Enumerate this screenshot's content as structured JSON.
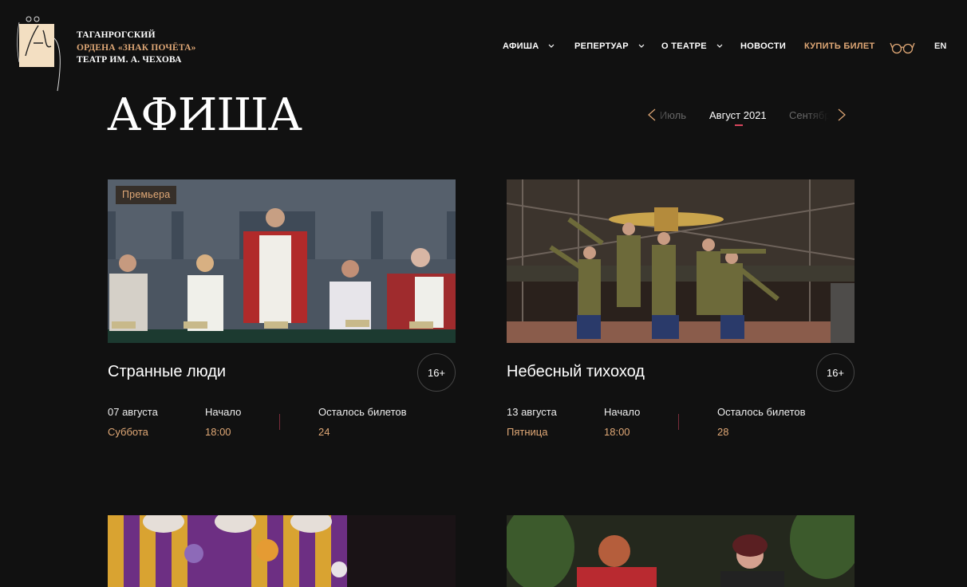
{
  "header": {
    "logo_line1": "ТАГАНРОГСКИЙ",
    "logo_line2": "ОРДЕНА «ЗНАК ПОЧЁТА»",
    "logo_line3": "ТЕАТР ИМ. А. ЧЕХОВА",
    "nav": [
      {
        "label": "АФИША",
        "has_dropdown": true
      },
      {
        "label": "РЕПЕРТУАР",
        "has_dropdown": true
      },
      {
        "label": "О ТЕАТРЕ",
        "has_dropdown": true
      },
      {
        "label": "НОВОСТИ",
        "has_dropdown": false
      },
      {
        "label": "КУПИТЬ БИЛЕТ",
        "has_dropdown": false
      }
    ],
    "accessibility_icon": "glasses-icon",
    "language": "EN"
  },
  "page": {
    "title": "АФИША"
  },
  "month_switcher": {
    "prev_label": "Июль",
    "current_label": "Август 2021",
    "next_label": "Сентябрь"
  },
  "events": [
    {
      "badge": "Премьера",
      "title": "Странные люди",
      "age": "16+",
      "date_label": "07 августа",
      "weekday": "Суббота",
      "start_label": "Начало",
      "start_time": "18:00",
      "tickets_label": "Осталось билетов",
      "tickets_left": "24"
    },
    {
      "badge": "",
      "title": "Небесный тихоход",
      "age": "16+",
      "date_label": "13 августа",
      "weekday": "Пятница",
      "start_label": "Начало",
      "start_time": "18:00",
      "tickets_label": "Осталось билетов",
      "tickets_left": "28"
    }
  ],
  "colors": {
    "background": "#111111",
    "accent": "#e0a876",
    "divider": "#7a2c3b",
    "underline": "#d9465d"
  }
}
